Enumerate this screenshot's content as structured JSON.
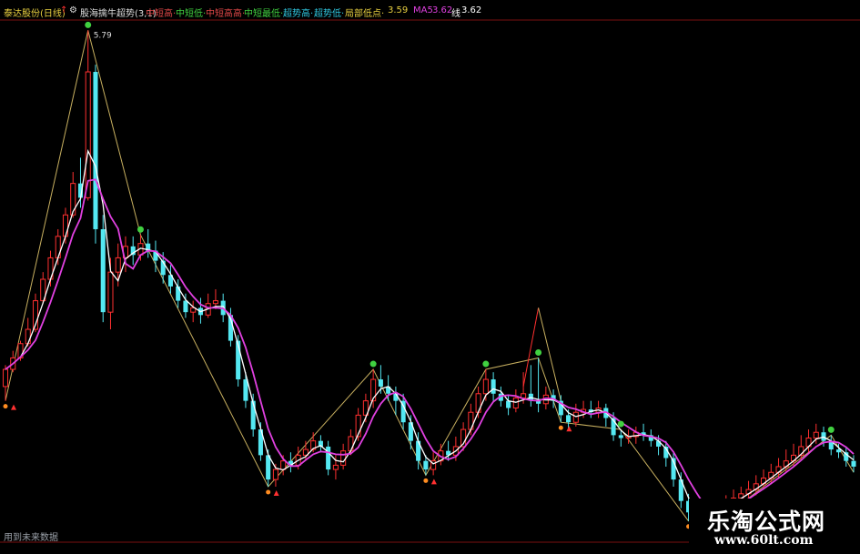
{
  "header": {
    "stock": "泰达股份(日线)",
    "indicator": "股海擒牛超势(3,1)",
    "items": [
      {
        "label": "中短高·",
        "color": "#e04848"
      },
      {
        "label": "中短低·",
        "color": "#40d040"
      },
      {
        "label": "中短高高·",
        "color": "#e04848"
      },
      {
        "label": "中短最低·",
        "color": "#40d040"
      },
      {
        "label": "超势高·",
        "color": "#30c8e0"
      },
      {
        "label": "超势低·",
        "color": "#30c8e0"
      }
    ],
    "last_label": "局部低点·",
    "last_value": "3.59",
    "ma_label": "MA5",
    "ma_value": "3.62",
    "trend_label": "线",
    "trend_value": "3.62"
  },
  "peak_label": "5.79",
  "bottom_note": "用到未来数据",
  "watermark": {
    "cn": "乐淘公式网",
    "url": "www.60lt.com"
  },
  "colors": {
    "up": "#ff3030",
    "down": "#54e8f2",
    "ma": "#e040e0",
    "ma2": "#ffffff",
    "zig": "#c8b060"
  },
  "chart_data": {
    "type": "candlestick",
    "title": "",
    "peak": 5.79,
    "candles": [
      [
        3.3,
        3.42,
        3.45,
        3.2
      ],
      [
        3.42,
        3.5,
        3.55,
        3.4
      ],
      [
        3.5,
        3.6,
        3.62,
        3.48
      ],
      [
        3.6,
        3.7,
        3.78,
        3.58
      ],
      [
        3.7,
        3.9,
        3.95,
        3.68
      ],
      [
        3.9,
        4.05,
        4.1,
        3.88
      ],
      [
        4.05,
        4.2,
        4.25,
        4.0
      ],
      [
        4.2,
        4.35,
        4.4,
        4.15
      ],
      [
        4.35,
        4.5,
        4.55,
        4.3
      ],
      [
        4.5,
        4.72,
        4.8,
        4.48
      ],
      [
        4.72,
        4.62,
        4.9,
        4.55
      ],
      [
        4.62,
        5.5,
        5.79,
        4.6
      ],
      [
        5.5,
        4.4,
        5.55,
        4.3
      ],
      [
        4.4,
        3.82,
        4.5,
        3.75
      ],
      [
        3.82,
        4.1,
        4.2,
        3.7
      ],
      [
        4.1,
        4.2,
        4.3,
        4.0
      ],
      [
        4.2,
        4.28,
        4.35,
        4.1
      ],
      [
        4.28,
        4.22,
        4.35,
        4.15
      ],
      [
        4.22,
        4.3,
        4.36,
        4.18
      ],
      [
        4.3,
        4.25,
        4.4,
        4.2
      ],
      [
        4.25,
        4.18,
        4.32,
        4.1
      ],
      [
        4.18,
        4.08,
        4.24,
        4.02
      ],
      [
        4.08,
        4.0,
        4.15,
        3.95
      ],
      [
        4.0,
        3.9,
        4.05,
        3.85
      ],
      [
        3.9,
        3.82,
        3.95,
        3.78
      ],
      [
        3.82,
        3.85,
        3.9,
        3.75
      ],
      [
        3.85,
        3.8,
        3.92,
        3.74
      ],
      [
        3.8,
        3.88,
        3.95,
        3.78
      ],
      [
        3.88,
        3.9,
        3.98,
        3.84
      ],
      [
        3.9,
        3.8,
        3.95,
        3.75
      ],
      [
        3.8,
        3.62,
        3.85,
        3.58
      ],
      [
        3.62,
        3.35,
        3.66,
        3.3
      ],
      [
        3.35,
        3.2,
        3.4,
        3.15
      ],
      [
        3.2,
        3.0,
        3.25,
        2.95
      ],
      [
        3.0,
        2.82,
        3.05,
        2.78
      ],
      [
        2.82,
        2.65,
        2.86,
        2.6
      ],
      [
        2.65,
        2.72,
        2.76,
        2.6
      ],
      [
        2.72,
        2.78,
        2.82,
        2.68
      ],
      [
        2.78,
        2.75,
        2.84,
        2.7
      ],
      [
        2.75,
        2.82,
        2.88,
        2.72
      ],
      [
        2.82,
        2.86,
        2.92,
        2.78
      ],
      [
        2.86,
        2.92,
        2.98,
        2.84
      ],
      [
        2.92,
        2.88,
        2.96,
        2.84
      ],
      [
        2.88,
        2.72,
        2.92,
        2.68
      ],
      [
        2.72,
        2.75,
        2.82,
        2.65
      ],
      [
        2.75,
        2.85,
        2.9,
        2.72
      ],
      [
        2.85,
        2.95,
        3.0,
        2.82
      ],
      [
        2.95,
        3.1,
        3.15,
        2.92
      ],
      [
        3.1,
        3.2,
        3.25,
        3.05
      ],
      [
        3.2,
        3.35,
        3.42,
        3.15
      ],
      [
        3.35,
        3.3,
        3.45,
        3.25
      ],
      [
        3.3,
        3.25,
        3.38,
        3.2
      ],
      [
        3.25,
        3.2,
        3.3,
        3.1
      ],
      [
        3.2,
        3.05,
        3.25,
        3.0
      ],
      [
        3.05,
        2.92,
        3.1,
        2.86
      ],
      [
        2.92,
        2.78,
        2.98,
        2.72
      ],
      [
        2.78,
        2.72,
        2.82,
        2.68
      ],
      [
        2.72,
        2.78,
        2.84,
        2.68
      ],
      [
        2.78,
        2.85,
        2.9,
        2.75
      ],
      [
        2.85,
        2.82,
        2.92,
        2.78
      ],
      [
        2.82,
        2.88,
        2.95,
        2.78
      ],
      [
        2.88,
        3.0,
        3.05,
        2.85
      ],
      [
        3.0,
        3.12,
        3.18,
        2.96
      ],
      [
        3.12,
        3.25,
        3.3,
        3.08
      ],
      [
        3.25,
        3.35,
        3.42,
        3.2
      ],
      [
        3.35,
        3.25,
        3.4,
        3.2
      ],
      [
        3.25,
        3.2,
        3.3,
        3.16
      ],
      [
        3.2,
        3.15,
        3.24,
        3.1
      ],
      [
        3.15,
        3.22,
        3.28,
        3.12
      ],
      [
        3.22,
        3.25,
        3.4,
        3.18
      ],
      [
        3.25,
        3.2,
        3.45,
        3.16
      ],
      [
        3.2,
        3.18,
        3.5,
        3.12
      ],
      [
        3.18,
        3.24,
        3.3,
        3.14
      ],
      [
        3.24,
        3.2,
        3.28,
        3.15
      ],
      [
        3.2,
        3.1,
        3.24,
        3.05
      ],
      [
        3.1,
        3.05,
        3.14,
        3.0
      ],
      [
        3.05,
        3.12,
        3.18,
        3.02
      ],
      [
        3.12,
        3.14,
        3.2,
        3.08
      ],
      [
        3.14,
        3.12,
        3.2,
        3.08
      ],
      [
        3.12,
        3.15,
        3.2,
        3.08
      ],
      [
        3.15,
        3.08,
        3.18,
        3.02
      ],
      [
        3.08,
        2.96,
        3.12,
        2.92
      ],
      [
        2.96,
        2.94,
        3.0,
        2.88
      ],
      [
        2.94,
        2.95,
        3.0,
        2.9
      ],
      [
        2.95,
        2.98,
        3.02,
        2.9
      ],
      [
        2.98,
        2.96,
        3.04,
        2.92
      ],
      [
        2.96,
        2.92,
        3.0,
        2.88
      ],
      [
        2.92,
        2.88,
        2.96,
        2.82
      ],
      [
        2.88,
        2.8,
        2.92,
        2.74
      ],
      [
        2.8,
        2.65,
        2.84,
        2.6
      ],
      [
        2.65,
        2.5,
        2.7,
        2.45
      ],
      [
        2.5,
        2.42,
        2.55,
        2.36
      ],
      [
        2.42,
        2.44,
        2.5,
        2.38
      ],
      [
        2.44,
        2.4,
        2.5,
        2.36
      ],
      [
        2.4,
        2.42,
        2.48,
        2.36
      ],
      [
        2.42,
        2.44,
        2.5,
        2.38
      ],
      [
        2.44,
        2.48,
        2.54,
        2.4
      ],
      [
        2.48,
        2.52,
        2.58,
        2.44
      ],
      [
        2.52,
        2.55,
        2.6,
        2.48
      ],
      [
        2.55,
        2.58,
        2.64,
        2.5
      ],
      [
        2.58,
        2.62,
        2.68,
        2.54
      ],
      [
        2.62,
        2.66,
        2.72,
        2.58
      ],
      [
        2.66,
        2.7,
        2.76,
        2.62
      ],
      [
        2.7,
        2.74,
        2.8,
        2.66
      ],
      [
        2.74,
        2.78,
        2.86,
        2.7
      ],
      [
        2.78,
        2.82,
        2.9,
        2.74
      ],
      [
        2.82,
        2.88,
        2.96,
        2.78
      ],
      [
        2.88,
        2.94,
        3.0,
        2.84
      ],
      [
        2.94,
        2.98,
        3.04,
        2.9
      ],
      [
        2.98,
        2.92,
        3.02,
        2.88
      ],
      [
        2.92,
        2.86,
        2.96,
        2.82
      ],
      [
        2.86,
        2.84,
        2.9,
        2.8
      ],
      [
        2.84,
        2.78,
        2.88,
        2.74
      ],
      [
        2.78,
        2.74,
        2.82,
        2.7
      ]
    ]
  }
}
